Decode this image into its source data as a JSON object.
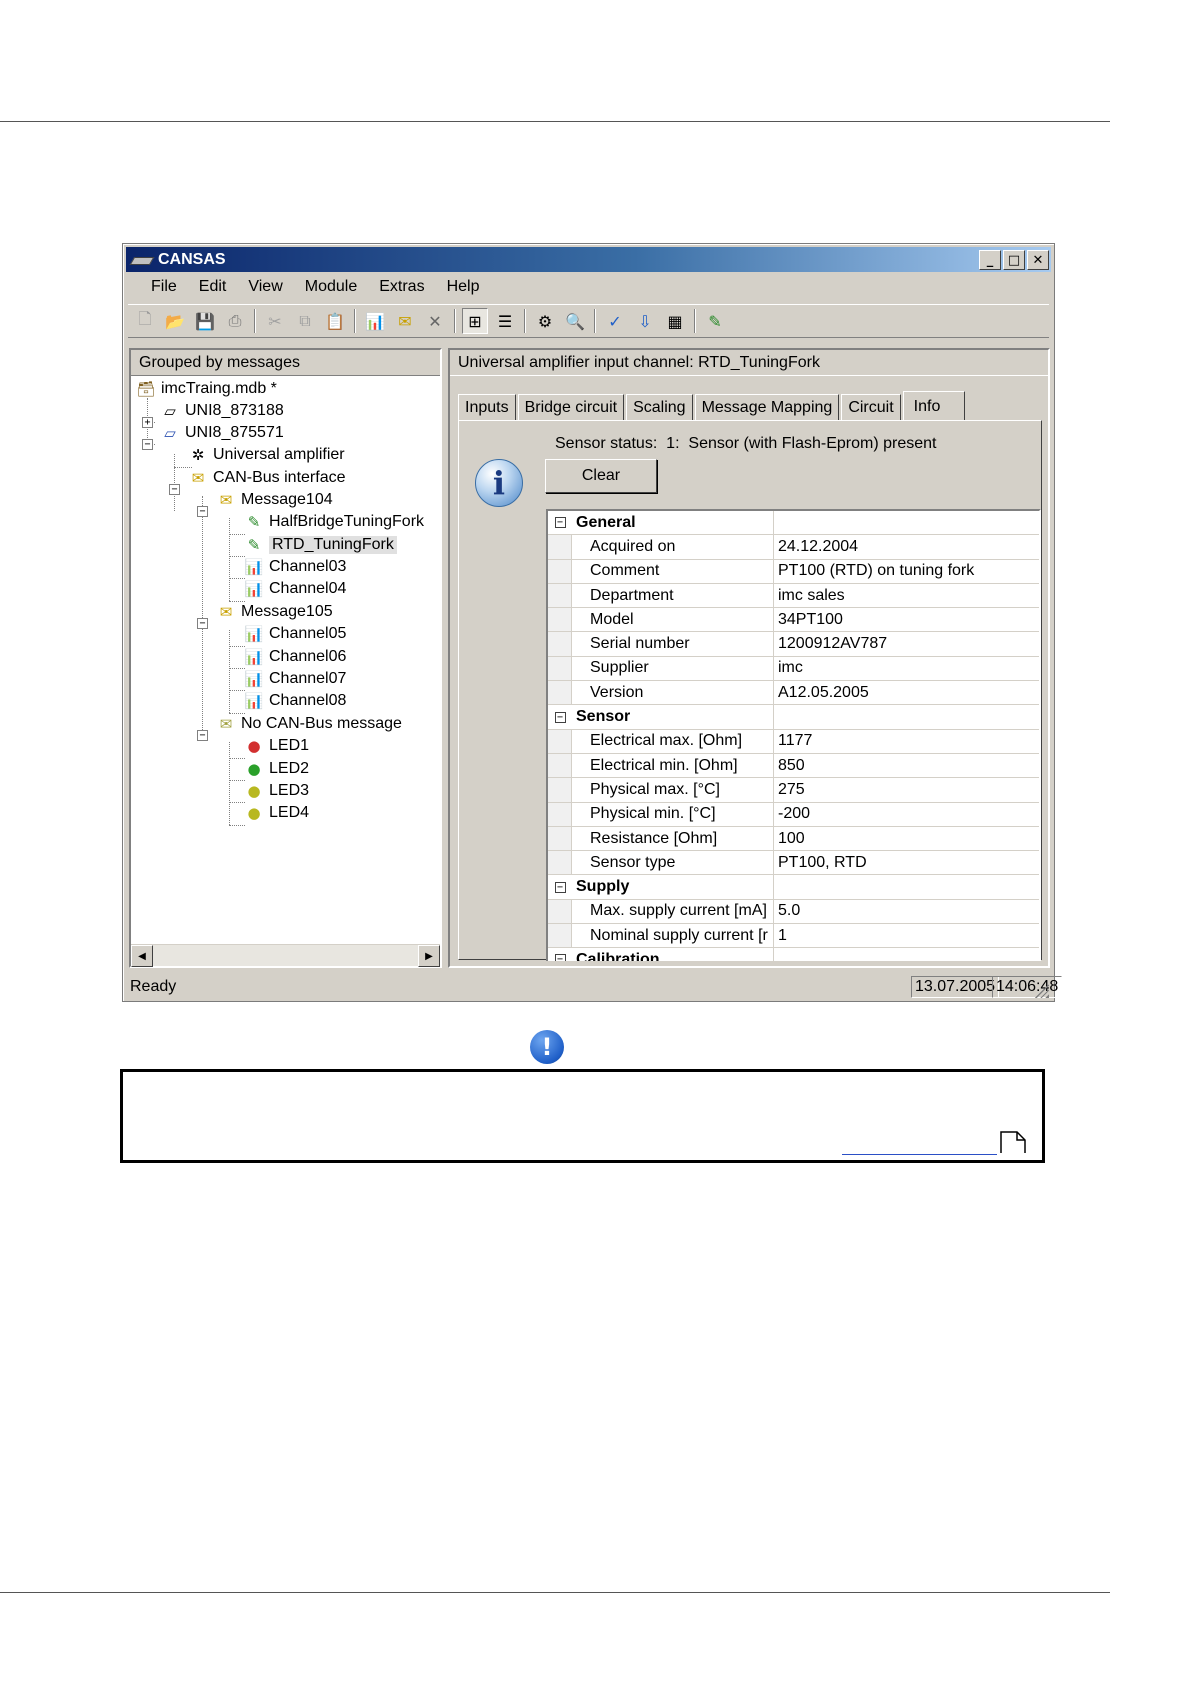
{
  "window": {
    "title": "CANSAS",
    "controls": {
      "minimize": "_",
      "maximize": "□",
      "close": "✕"
    }
  },
  "menu": [
    "File",
    "Edit",
    "View",
    "Module",
    "Extras",
    "Help"
  ],
  "toolbar": {
    "icons": [
      "new-icon",
      "open-icon",
      "save-icon",
      "print-icon",
      "cut-icon",
      "copy-icon",
      "paste-icon",
      "new-channel-icon",
      "new-message-icon",
      "delete-icon",
      "group-by-messages-icon",
      "group-by-modules-icon",
      "integrate-icon",
      "find-icon",
      "check-icon",
      "prepare-icon",
      "display-icon",
      "measure-icon"
    ]
  },
  "tree": {
    "header": "Grouped by messages",
    "items": [
      {
        "label": "imcTraing.mdb *",
        "icon": "database-icon"
      },
      {
        "label": "UNI8_873188",
        "icon": "module-icon",
        "expander": "+"
      },
      {
        "label": "UNI8_875571",
        "icon": "module-icon",
        "expander": "−"
      },
      {
        "label": "Universal amplifier",
        "icon": "amplifier-icon"
      },
      {
        "label": "CAN-Bus interface",
        "icon": "can-interface-icon",
        "expander": "−"
      },
      {
        "label": "Message104",
        "icon": "message-icon",
        "expander": "−"
      },
      {
        "label": "HalfBridgeTuningFork",
        "icon": "sensor-channel-icon"
      },
      {
        "label": "RTD_TuningFork",
        "icon": "sensor-channel-icon",
        "selected": true
      },
      {
        "label": "Channel03",
        "icon": "channel-icon"
      },
      {
        "label": "Channel04",
        "icon": "channel-icon"
      },
      {
        "label": "Message105",
        "icon": "message-icon",
        "expander": "−"
      },
      {
        "label": "Channel05",
        "icon": "channel-icon"
      },
      {
        "label": "Channel06",
        "icon": "channel-icon"
      },
      {
        "label": "Channel07",
        "icon": "channel-icon"
      },
      {
        "label": "Channel08",
        "icon": "channel-icon"
      },
      {
        "label": "No CAN-Bus message",
        "icon": "no-message-icon",
        "expander": "−"
      },
      {
        "label": "LED1",
        "icon": "led-icon",
        "color": "#d23030"
      },
      {
        "label": "LED2",
        "icon": "led-icon",
        "color": "#2aa02a"
      },
      {
        "label": "LED3",
        "icon": "led-icon",
        "color": "#b8b820"
      },
      {
        "label": "LED4",
        "icon": "led-icon",
        "color": "#b8b820"
      }
    ]
  },
  "detail": {
    "header": "Universal amplifier input channel: RTD_TuningFork",
    "tabs": [
      "Inputs",
      "Bridge circuit",
      "Scaling",
      "Message Mapping",
      "Circuit",
      "Info"
    ],
    "active_tab": "Info",
    "sensor_status": "Sensor status:  1:  Sensor (with Flash-Eprom) present",
    "clear_button": "Clear",
    "grid": [
      {
        "category": "General"
      },
      {
        "name": "Acquired on",
        "value": "24.12.2004"
      },
      {
        "name": "Comment",
        "value": "PT100 (RTD) on tuning fork"
      },
      {
        "name": "Department",
        "value": "imc sales"
      },
      {
        "name": "Model",
        "value": "34PT100"
      },
      {
        "name": "Serial number",
        "value": "1200912AV787"
      },
      {
        "name": "Supplier",
        "value": "imc"
      },
      {
        "name": "Version",
        "value": "A12.05.2005"
      },
      {
        "category": "Sensor"
      },
      {
        "name": "Electrical max. [Ohm]",
        "value": "1177"
      },
      {
        "name": "Electrical min. [Ohm]",
        "value": "850"
      },
      {
        "name": "Physical max. [°C]",
        "value": "275"
      },
      {
        "name": "Physical min. [°C]",
        "value": "-200"
      },
      {
        "name": "Resistance [Ohm]",
        "value": "100"
      },
      {
        "name": "Sensor type",
        "value": "PT100, RTD"
      },
      {
        "category": "Supply"
      },
      {
        "name": "Max. supply current [mA]",
        "value": "5.0"
      },
      {
        "name": "Nominal supply current [r",
        "value": "1"
      },
      {
        "category": "Calibration"
      }
    ]
  },
  "status": {
    "text": "Ready",
    "date": "13.07.2005",
    "time": "14:06:48"
  }
}
